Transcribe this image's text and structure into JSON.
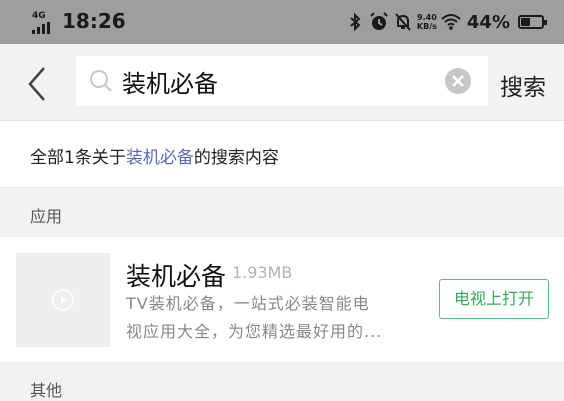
{
  "status_bar": {
    "network": "4G",
    "time": "18:26",
    "net_speed_value": "9.40",
    "net_speed_unit": "KB/s",
    "battery_percent": "44%",
    "battery_level": 0.44,
    "icons": [
      "bluetooth-icon",
      "alarm-icon",
      "mute-icon",
      "wifi-icon",
      "battery-icon"
    ]
  },
  "search": {
    "query": "装机必备",
    "button_label": "搜索"
  },
  "summary": {
    "prefix": "全部1条关于",
    "keyword": "装机必备",
    "suffix": "的搜索内容",
    "keyword_color": "#5b6bb3"
  },
  "sections": {
    "apps_label": "应用",
    "other_label": "其他"
  },
  "app": {
    "name": "装机必备",
    "size": "1.93MB",
    "description_line1": "TV装机必备，一站式必装智能电",
    "description_line2": "视应用大全，为您精选最好用的...",
    "action_label": "电视上打开",
    "action_color": "#37a75a"
  }
}
